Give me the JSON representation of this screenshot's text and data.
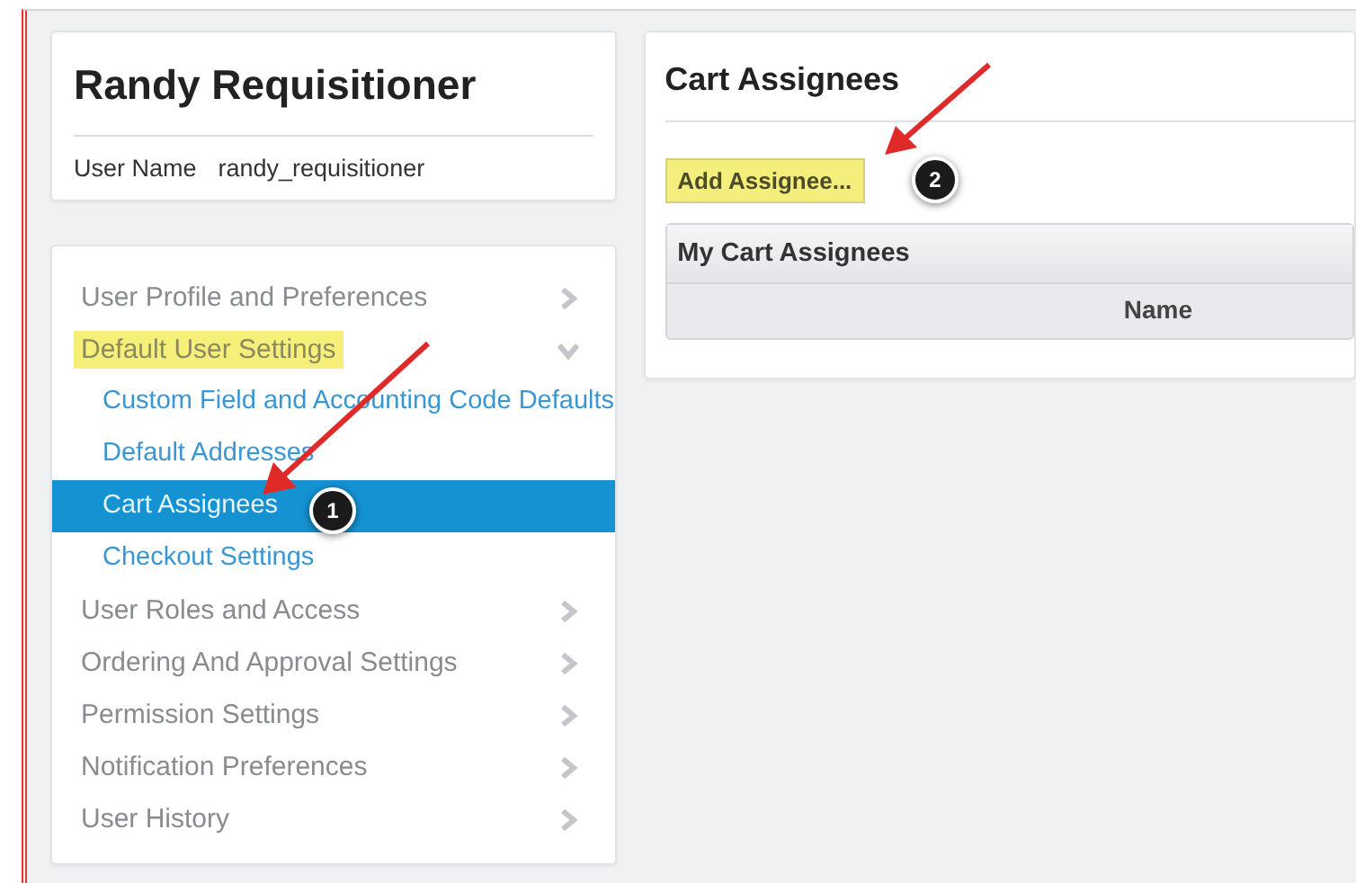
{
  "profile": {
    "name": "Randy Requisitioner",
    "field_label": "User Name",
    "field_value": "randy_requisitioner"
  },
  "nav": [
    {
      "label": "User Profile and Preferences",
      "expanded": false,
      "highlighted": false
    },
    {
      "label": "Default User Settings",
      "expanded": true,
      "highlighted": true,
      "children": [
        {
          "label": "Custom Field and Accounting Code Defaults",
          "selected": false
        },
        {
          "label": "Default Addresses",
          "selected": false
        },
        {
          "label": "Cart Assignees",
          "selected": true
        },
        {
          "label": "Checkout Settings",
          "selected": false
        }
      ]
    },
    {
      "label": "User Roles and Access",
      "expanded": false,
      "highlighted": false
    },
    {
      "label": "Ordering And Approval Settings",
      "expanded": false,
      "highlighted": false
    },
    {
      "label": "Permission Settings",
      "expanded": false,
      "highlighted": false
    },
    {
      "label": "Notification Preferences",
      "expanded": false,
      "highlighted": false
    },
    {
      "label": "User History",
      "expanded": false,
      "highlighted": false
    }
  ],
  "panel": {
    "title": "Cart Assignees",
    "button": {
      "label": "Add Assignee...",
      "highlighted": true
    },
    "table": {
      "title": "My Cart Assignees",
      "columns": [
        "Name"
      ]
    }
  },
  "callouts": [
    {
      "number": "1"
    },
    {
      "number": "2"
    }
  ]
}
